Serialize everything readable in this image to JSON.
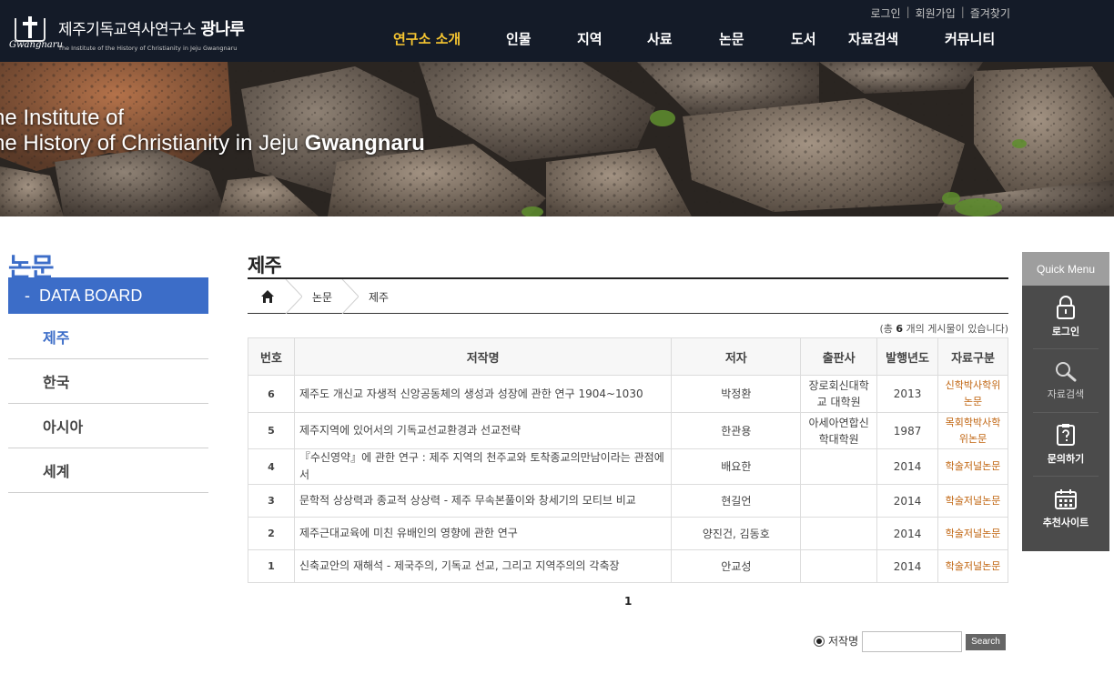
{
  "logo": {
    "script": "Gwangnaru",
    "name_prefix": "제주기독교역사연구소",
    "name_bold": "광나루",
    "english": "The Institute of the History of Christianity in Jeju Gwangnaru"
  },
  "top_links": [
    "로그인",
    "회원가입",
    "즐겨찾기"
  ],
  "top_link_separator": "|",
  "gnb": [
    {
      "label": "연구소 소개",
      "active": true
    },
    {
      "label": "인물",
      "active": false
    },
    {
      "label": "지역",
      "active": false
    },
    {
      "label": "사료",
      "active": false
    },
    {
      "label": "논문",
      "active": false
    },
    {
      "label": "도서",
      "active": false
    },
    {
      "label": "자료검색",
      "active": false
    },
    {
      "label": "커뮤니티",
      "active": false
    }
  ],
  "banner": {
    "line1": "he Institute of",
    "line2_regular": "he History of Christianity in Jeju ",
    "line2_bold": "Gwangnaru"
  },
  "lnb": {
    "title": "논문",
    "board_dash": "-",
    "board_label": "DATA BOARD",
    "items": [
      {
        "label": "제주",
        "current": true
      },
      {
        "label": "한국",
        "current": false
      },
      {
        "label": "아시아",
        "current": false
      },
      {
        "label": "세계",
        "current": false
      }
    ]
  },
  "content": {
    "title": "제주",
    "breadcrumb": [
      "논문",
      "제주"
    ],
    "count_prefix": "(총 ",
    "count_value": "6",
    "count_suffix": " 개의 게시물이 있습니다)",
    "columns": [
      "번호",
      "저작명",
      "저자",
      "출판사",
      "발행년도",
      "자료구분"
    ],
    "rows": [
      {
        "no": "6",
        "title": "제주도 개신교 자생적 신앙공동체의 생성과 성장에 관한 연구 1904~1030",
        "author": "박정환",
        "publisher": "장로회신대학교 대학원",
        "year": "2013",
        "type": "신학박사학위논문"
      },
      {
        "no": "5",
        "title": "제주지역에 있어서의 기독교선교환경과 선교전략",
        "author": "한관용",
        "publisher": "아세아연합신학대학원",
        "year": "1987",
        "type": "목회학박사학위논문"
      },
      {
        "no": "4",
        "title": "『수신영약』에 관한 연구 : 제주 지역의 천주교와 토착종교의만남이라는 관점에서",
        "author": "배요한",
        "publisher": "",
        "year": "2014",
        "type": "학술저널논문"
      },
      {
        "no": "3",
        "title": "문학적 상상력과 종교적 상상력 - 제주 무속본풀이와 창세기의 모티브 비교",
        "author": "현길언",
        "publisher": "",
        "year": "2014",
        "type": "학술저널논문"
      },
      {
        "no": "2",
        "title": "제주근대교육에 미친 유배인의 영향에 관한 연구",
        "author": "양진건, 김동호",
        "publisher": "",
        "year": "2014",
        "type": "학술저널논문"
      },
      {
        "no": "1",
        "title": "신축교안의 재해석 - 제국주의, 기독교 선교, 그리고 지역주의의 각축장",
        "author": "안교성",
        "publisher": "",
        "year": "2014",
        "type": "학술저널논문"
      }
    ],
    "page": "1",
    "search": {
      "option_label": "저작명",
      "value": "",
      "button": "Search"
    }
  },
  "quick_menu": {
    "title": "Quick Menu",
    "items": [
      {
        "label": "로그인",
        "icon": "lock-icon"
      },
      {
        "label": "자료검색",
        "icon": "search-icon"
      },
      {
        "label": "문의하기",
        "icon": "clipboard-question-icon"
      },
      {
        "label": "추천사이트",
        "icon": "calendar-icon"
      }
    ]
  }
}
